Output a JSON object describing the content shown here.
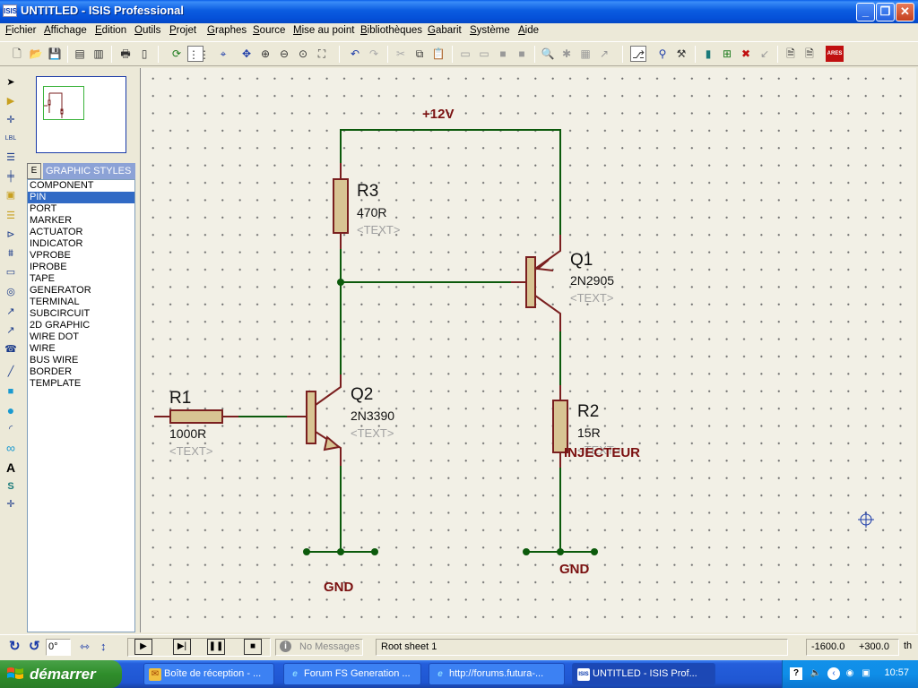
{
  "window": {
    "title": "UNTITLED - ISIS Professional",
    "icon_label": "ISIS",
    "controls": {
      "minimize_icon": "minimize-icon",
      "maximize_icon": "restore-icon",
      "close_icon": "close-icon"
    }
  },
  "menu": [
    "Fichier",
    "Affichage",
    "Edition",
    "Outils",
    "Projet",
    "Graphes",
    "Source",
    "Mise au point",
    "Bibliothèques",
    "Gabarit",
    "Système",
    "Aide"
  ],
  "toolbar": {
    "icons": [
      "new-file-icon",
      "open-folder-icon",
      "save-icon",
      "import-icon",
      "export-icon",
      "print-icon",
      "page-setup-icon",
      "refresh-icon",
      "grid-icon",
      "origin-icon",
      "pan-icon",
      "zoom-in-icon",
      "zoom-out-icon",
      "zoom-all-icon",
      "zoom-area-icon",
      "undo-icon",
      "redo-icon",
      "cut-icon",
      "copy-icon",
      "paste-icon",
      "block-copy-icon",
      "block-move-icon",
      "block-rotate-icon",
      "block-delete-icon",
      "pick-device-icon",
      "make-device-icon",
      "package-icon",
      "decompose-icon",
      "wire-autorouter-icon",
      "search-icon",
      "property-tool-icon",
      "new-sheet-icon",
      "remove-sheet-icon",
      "exit-to-parent-icon",
      "bill-of-materials-icon",
      "electrical-rules-check-icon",
      "netlist-to-ares-icon"
    ],
    "ares_label": "ARES"
  },
  "left_tools": [
    "selection-mode-icon",
    "component-mode-icon",
    "junction-dot-icon",
    "wire-label-icon",
    "text-script-icon",
    "bus-icon",
    "subcircuit-icon",
    "terminal-icon",
    "device-pin-icon",
    "graph-icon",
    "tape-recorder-icon",
    "generator-icon",
    "voltage-probe-icon",
    "current-probe-icon",
    "virtual-instrument-icon",
    "line-icon",
    "box-icon",
    "circle-icon",
    "arc-icon",
    "path-icon",
    "text-icon",
    "symbol-icon",
    "marker-icon"
  ],
  "panel": {
    "mode_button": "E",
    "title": "GRAPHIC STYLES",
    "items": [
      "COMPONENT",
      "PIN",
      "PORT",
      "MARKER",
      "ACTUATOR",
      "INDICATOR",
      "VPROBE",
      "IPROBE",
      "TAPE",
      "GENERATOR",
      "TERMINAL",
      "SUBCIRCUIT",
      "2D GRAPHIC",
      "WIRE DOT",
      "WIRE",
      "BUS WIRE",
      "BORDER",
      "TEMPLATE"
    ],
    "selected": "PIN"
  },
  "schematic": {
    "colors": {
      "wire": "#0c5a0c",
      "body": "#7a1f1f",
      "fill": "#d8c493",
      "label": "#7a1010",
      "text_hidden": "#a0a0a0"
    },
    "power_label": "+12V",
    "ground_labels": [
      "GND",
      "GND"
    ],
    "components": [
      {
        "ref": "R1",
        "value": "1000R",
        "text": "<TEXT>"
      },
      {
        "ref": "R2",
        "value": "15R",
        "text": "<TEXT>"
      },
      {
        "ref": "R3",
        "value": "470R",
        "text": "<TEXT>"
      },
      {
        "ref": "Q1",
        "value": "2N2905",
        "text": "<TEXT>"
      },
      {
        "ref": "Q2",
        "value": "2N3390",
        "text": "<TEXT>"
      }
    ],
    "annotation": "INJECTEUR"
  },
  "status": {
    "rotation": "0°",
    "messages": "No Messages",
    "sheet": "Root sheet 1",
    "coord_x": "-1600.0",
    "coord_y": "+300.0",
    "unit": "th"
  },
  "taskbar": {
    "start": "démarrer",
    "tasks": [
      {
        "label": "Boîte de réception - ...",
        "icon": "mail-icon"
      },
      {
        "label": "Forum FS Generation ...",
        "icon": "browser-icon"
      },
      {
        "label": "http://forums.futura-...",
        "icon": "browser-icon"
      },
      {
        "label": "UNTITLED - ISIS Prof...",
        "icon": "isis-app-icon"
      }
    ],
    "clock": "10:57"
  }
}
